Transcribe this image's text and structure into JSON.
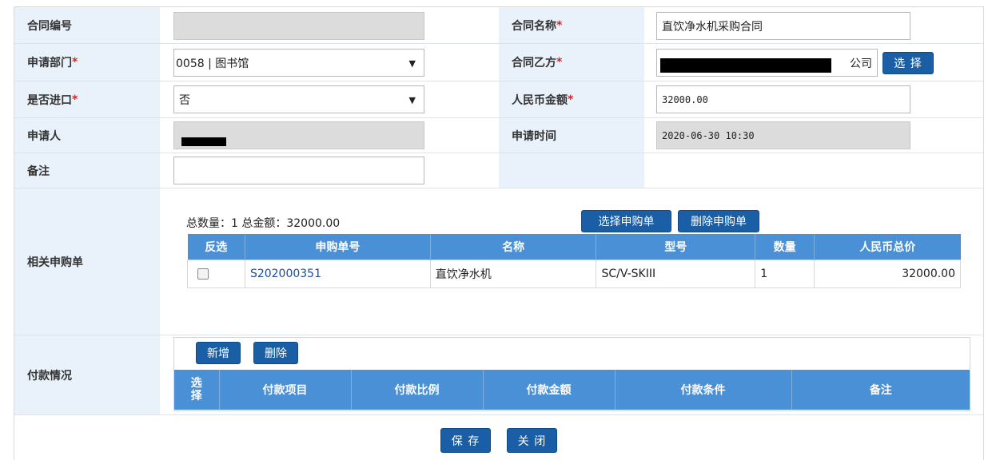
{
  "form": {
    "contract_no_label": "合同编号",
    "contract_no_value": "",
    "contract_name_label": "合同名称",
    "contract_name_value": "直饮净水机采购合同",
    "dept_label": "申请部门",
    "dept_value": "0058 | 图书馆",
    "party_b_label": "合同乙方",
    "party_b_visible_suffix": "公司",
    "party_b_select_btn": "选 择",
    "imported_label": "是否进口",
    "imported_value": "否",
    "rmb_label": "人民币金额",
    "rmb_value": "32000.00",
    "applicant_label": "申请人",
    "apply_time_label": "申请时间",
    "apply_time_value": "2020-06-30 10:30",
    "remark_label": "备注",
    "remark_value": "",
    "required_mark": "*"
  },
  "purchase": {
    "section_label": "相关申购单",
    "summary": "总数量：1   总金额：32000.00",
    "select_btn": "选择申购单",
    "delete_btn": "删除申购单",
    "columns": [
      "反选",
      "申购单号",
      "名称",
      "型号",
      "数量",
      "人民币总价"
    ],
    "rows": [
      {
        "no": "S202000351",
        "name": "直饮净水机",
        "model": "SC/V-SKIII",
        "qty": "1",
        "total": "32000.00"
      }
    ]
  },
  "payment": {
    "section_label": "付款情况",
    "add_btn": "新增",
    "delete_btn": "删除",
    "columns": [
      "选择",
      "付款项目",
      "付款比例",
      "付款金额",
      "付款条件",
      "备注"
    ]
  },
  "footer": {
    "save_btn": "保 存",
    "close_btn": "关 闭"
  },
  "colors": {
    "label_bg": "#e9f1fa",
    "button_blue": "#1a5fa6",
    "table_header": "#4a90d6",
    "required": "#e02020"
  },
  "icons": {
    "dropdown": "caret-down-icon",
    "checkbox": "checkbox-icon"
  }
}
